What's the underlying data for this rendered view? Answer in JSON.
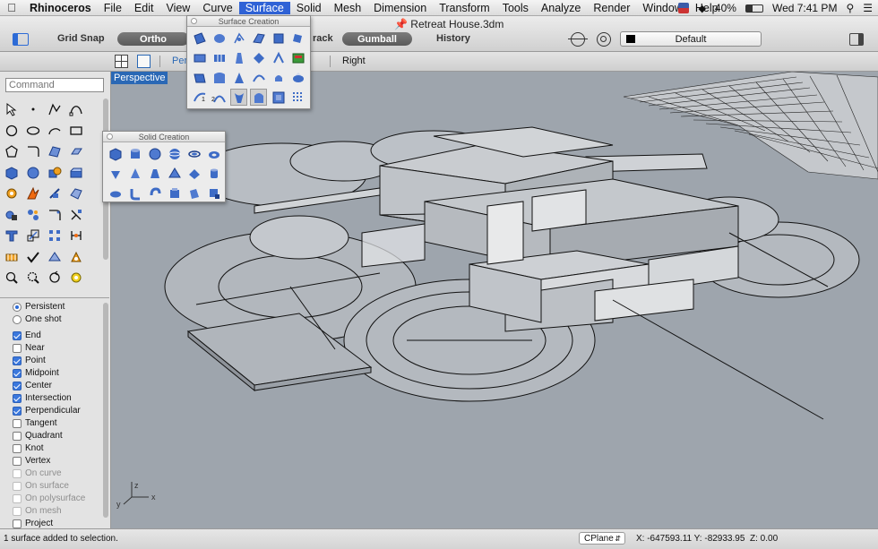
{
  "menubar": {
    "items": [
      "Rhinoceros",
      "File",
      "Edit",
      "View",
      "Curve",
      "Surface",
      "Solid",
      "Mesh",
      "Dimension",
      "Transform",
      "Tools",
      "Analyze",
      "Render",
      "Window",
      "Help"
    ],
    "active_index": 5,
    "battery": "40%",
    "clock": "Wed 7:41 PM"
  },
  "window": {
    "title": "Retreat House.3dm"
  },
  "toolbar": {
    "grid_snap": "Grid Snap",
    "ortho": "Ortho",
    "track_partial": "rack",
    "gumball": "Gumball",
    "history": "History",
    "layer": "Default"
  },
  "viewtabs": {
    "perspective_partial": "Pers",
    "top_partial": "t",
    "right": "Right"
  },
  "command": {
    "placeholder": "Command"
  },
  "viewport": {
    "label": "Perspective"
  },
  "surface_creation": {
    "title": "Surface Creation",
    "badge1": "1",
    "badge2": "2"
  },
  "solid_creation": {
    "title": "Solid Creation"
  },
  "osnap": {
    "modes": [
      {
        "label": "Persistent",
        "on": true
      },
      {
        "label": "One shot",
        "on": false
      }
    ],
    "items": [
      {
        "label": "End",
        "checked": true,
        "dim": false
      },
      {
        "label": "Near",
        "checked": false,
        "dim": false
      },
      {
        "label": "Point",
        "checked": true,
        "dim": false
      },
      {
        "label": "Midpoint",
        "checked": true,
        "dim": false
      },
      {
        "label": "Center",
        "checked": true,
        "dim": false
      },
      {
        "label": "Intersection",
        "checked": true,
        "dim": false
      },
      {
        "label": "Perpendicular",
        "checked": true,
        "dim": false
      },
      {
        "label": "Tangent",
        "checked": false,
        "dim": false
      },
      {
        "label": "Quadrant",
        "checked": false,
        "dim": false
      },
      {
        "label": "Knot",
        "checked": false,
        "dim": false
      },
      {
        "label": "Vertex",
        "checked": false,
        "dim": false
      },
      {
        "label": "On curve",
        "checked": false,
        "dim": true
      },
      {
        "label": "On surface",
        "checked": false,
        "dim": true
      },
      {
        "label": "On polysurface",
        "checked": false,
        "dim": true
      },
      {
        "label": "On mesh",
        "checked": false,
        "dim": true
      },
      {
        "label": "Project",
        "checked": false,
        "dim": false
      }
    ]
  },
  "status": {
    "message": "1 surface added to selection.",
    "cplane": "CPlane",
    "coords": "X: -647593.11 Y: -82933.95",
    "z": "Z: 0.00"
  },
  "axes": {
    "x": "x",
    "y": "y",
    "z": "z"
  },
  "colors": {
    "accent": "#2a68b5",
    "viewport_bg": "#9ea5ad",
    "icon_blue": "#3e6cc6"
  }
}
